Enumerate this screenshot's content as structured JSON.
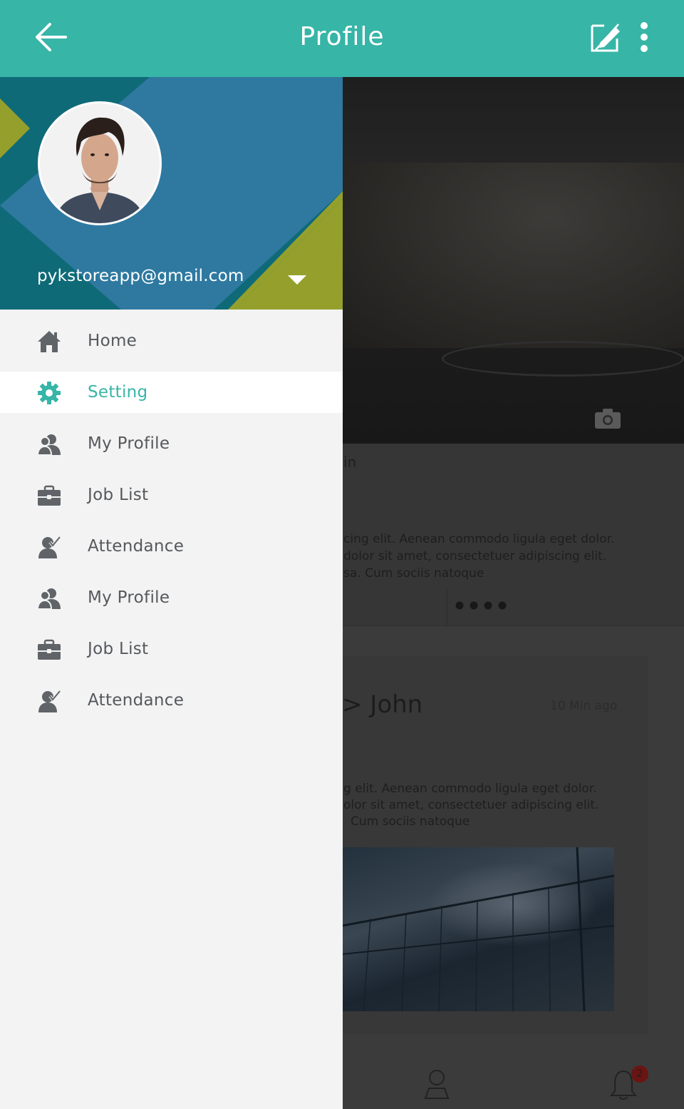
{
  "appbar": {
    "title": "Profile",
    "back_icon": "arrow-left-icon",
    "edit_icon": "edit-icon",
    "more_icon": "more-vert-icon"
  },
  "drawer": {
    "email": "pykstoreapp@gmail.com",
    "menu": [
      {
        "label": "Home",
        "icon": "home-icon",
        "active": false
      },
      {
        "label": "Setting",
        "icon": "gear-icon",
        "active": true
      },
      {
        "label": "My Profile",
        "icon": "users-icon",
        "active": false
      },
      {
        "label": "Job List",
        "icon": "briefcase-icon",
        "active": false
      },
      {
        "label": "Attendance",
        "icon": "attendance-icon",
        "active": false
      },
      {
        "label": "My Profile",
        "icon": "users-icon",
        "active": false
      },
      {
        "label": "Job List",
        "icon": "briefcase-icon",
        "active": false
      },
      {
        "label": "Attendance",
        "icon": "attendance-icon",
        "active": false
      }
    ]
  },
  "background": {
    "post_text_1": "cing elit. Aenean commodo ligula eget dolor.",
    "post_text_2": "dolor sit amet, consectetuer adipiscing elit.",
    "post_text_3": "sa. Cum sociis natoque",
    "partial_word": "in",
    "card_name": "> John",
    "card_time": "10 Min ago",
    "card_text_1": "g elit. Aenean commodo ligula eget dolor.",
    "card_text_2": "olor sit amet, consectetuer adipiscing elit.",
    "card_text_3": "Cum sociis natoque",
    "notification_count": "2"
  },
  "colors": {
    "accent": "#37b5a7",
    "header_dark": "#0f6a78",
    "header_blue": "#2f79a0",
    "header_olive": "#94a02b",
    "menu_text": "#55585c"
  }
}
